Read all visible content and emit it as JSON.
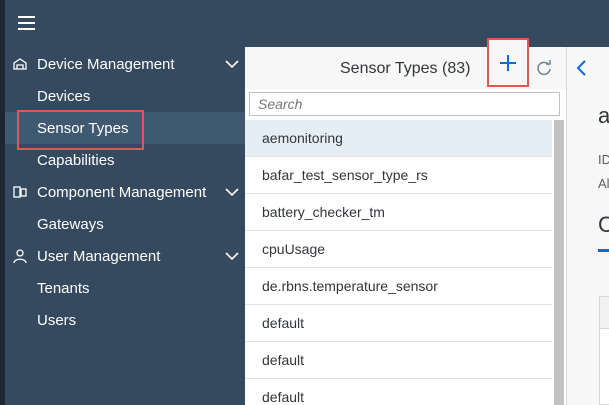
{
  "colors": {
    "shell": "#354a5f",
    "highlight_box": "#e05a4b",
    "selected_row": "#e5eef5",
    "accent": "#0a6ed1"
  },
  "header": {
    "menu_icon": "hamburger-menu-icon"
  },
  "sidebar": {
    "groups": [
      {
        "label": "Device Management",
        "icon": "device-management-icon",
        "expanded": true,
        "items": [
          {
            "label": "Devices"
          },
          {
            "label": "Sensor Types",
            "selected": true
          },
          {
            "label": "Capabilities"
          }
        ]
      },
      {
        "label": "Component Management",
        "icon": "component-management-icon",
        "expanded": true,
        "items": [
          {
            "label": "Gateways"
          }
        ]
      },
      {
        "label": "User Management",
        "icon": "user-icon",
        "expanded": true,
        "items": [
          {
            "label": "Tenants"
          },
          {
            "label": "Users"
          }
        ]
      }
    ]
  },
  "master": {
    "title": "Sensor Types (83)",
    "add_icon": "plus-icon",
    "refresh_icon": "refresh-icon",
    "search_placeholder": "Search",
    "items": [
      "aemonitoring",
      "bafar_test_sensor_type_rs",
      "battery_checker_tm",
      "cpuUsage",
      "de.rbns.temperature_sensor",
      "default",
      "default",
      "default"
    ],
    "selected_index": 0
  },
  "detail": {
    "back_icon": "chevron-left-icon",
    "title_fragment": "a",
    "meta_lines": [
      "ID",
      "Al"
    ],
    "tab_fragment": "C"
  }
}
